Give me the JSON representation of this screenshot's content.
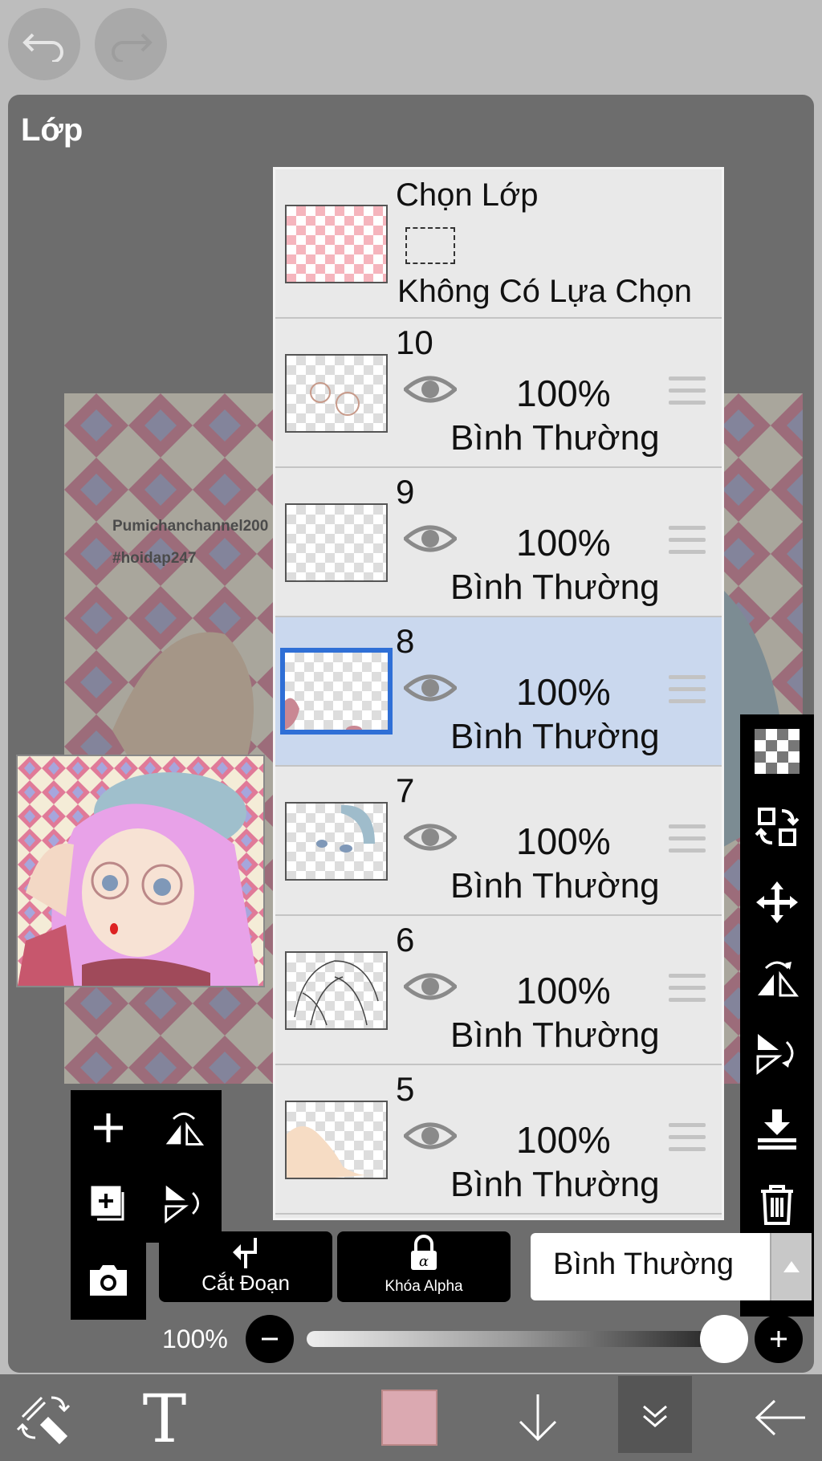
{
  "topbar": {
    "undo_icon": "undo-icon",
    "redo_icon": "redo-icon"
  },
  "panel": {
    "title": "Lớp"
  },
  "canvas": {
    "watermark_line1": "Pumichanchannel200",
    "watermark_line2": "#hoidap247"
  },
  "selection_row": {
    "title": "Chọn Lớp",
    "status": "Không Có Lựa Chọn"
  },
  "layers": [
    {
      "number": "10",
      "opacity": "100%",
      "blend": "Bình Thường",
      "selected": false
    },
    {
      "number": "9",
      "opacity": "100%",
      "blend": "Bình Thường",
      "selected": false
    },
    {
      "number": "8",
      "opacity": "100%",
      "blend": "Bình Thường",
      "selected": true
    },
    {
      "number": "7",
      "opacity": "100%",
      "blend": "Bình Thường",
      "selected": false
    },
    {
      "number": "6",
      "opacity": "100%",
      "blend": "Bình Thường",
      "selected": false
    },
    {
      "number": "5",
      "opacity": "100%",
      "blend": "Bình Thường",
      "selected": false
    }
  ],
  "bottom_controls": {
    "clipping_label": "Cắt Đoạn",
    "alpha_lock_label": "Khóa Alpha",
    "blend_mode_value": "Bình Thường",
    "opacity_label": "100%",
    "opacity_value": 1.0
  },
  "colors": {
    "accent": "#2f6fd6",
    "selected_row": "#cad8ee",
    "current_color": "#dba9b1"
  }
}
